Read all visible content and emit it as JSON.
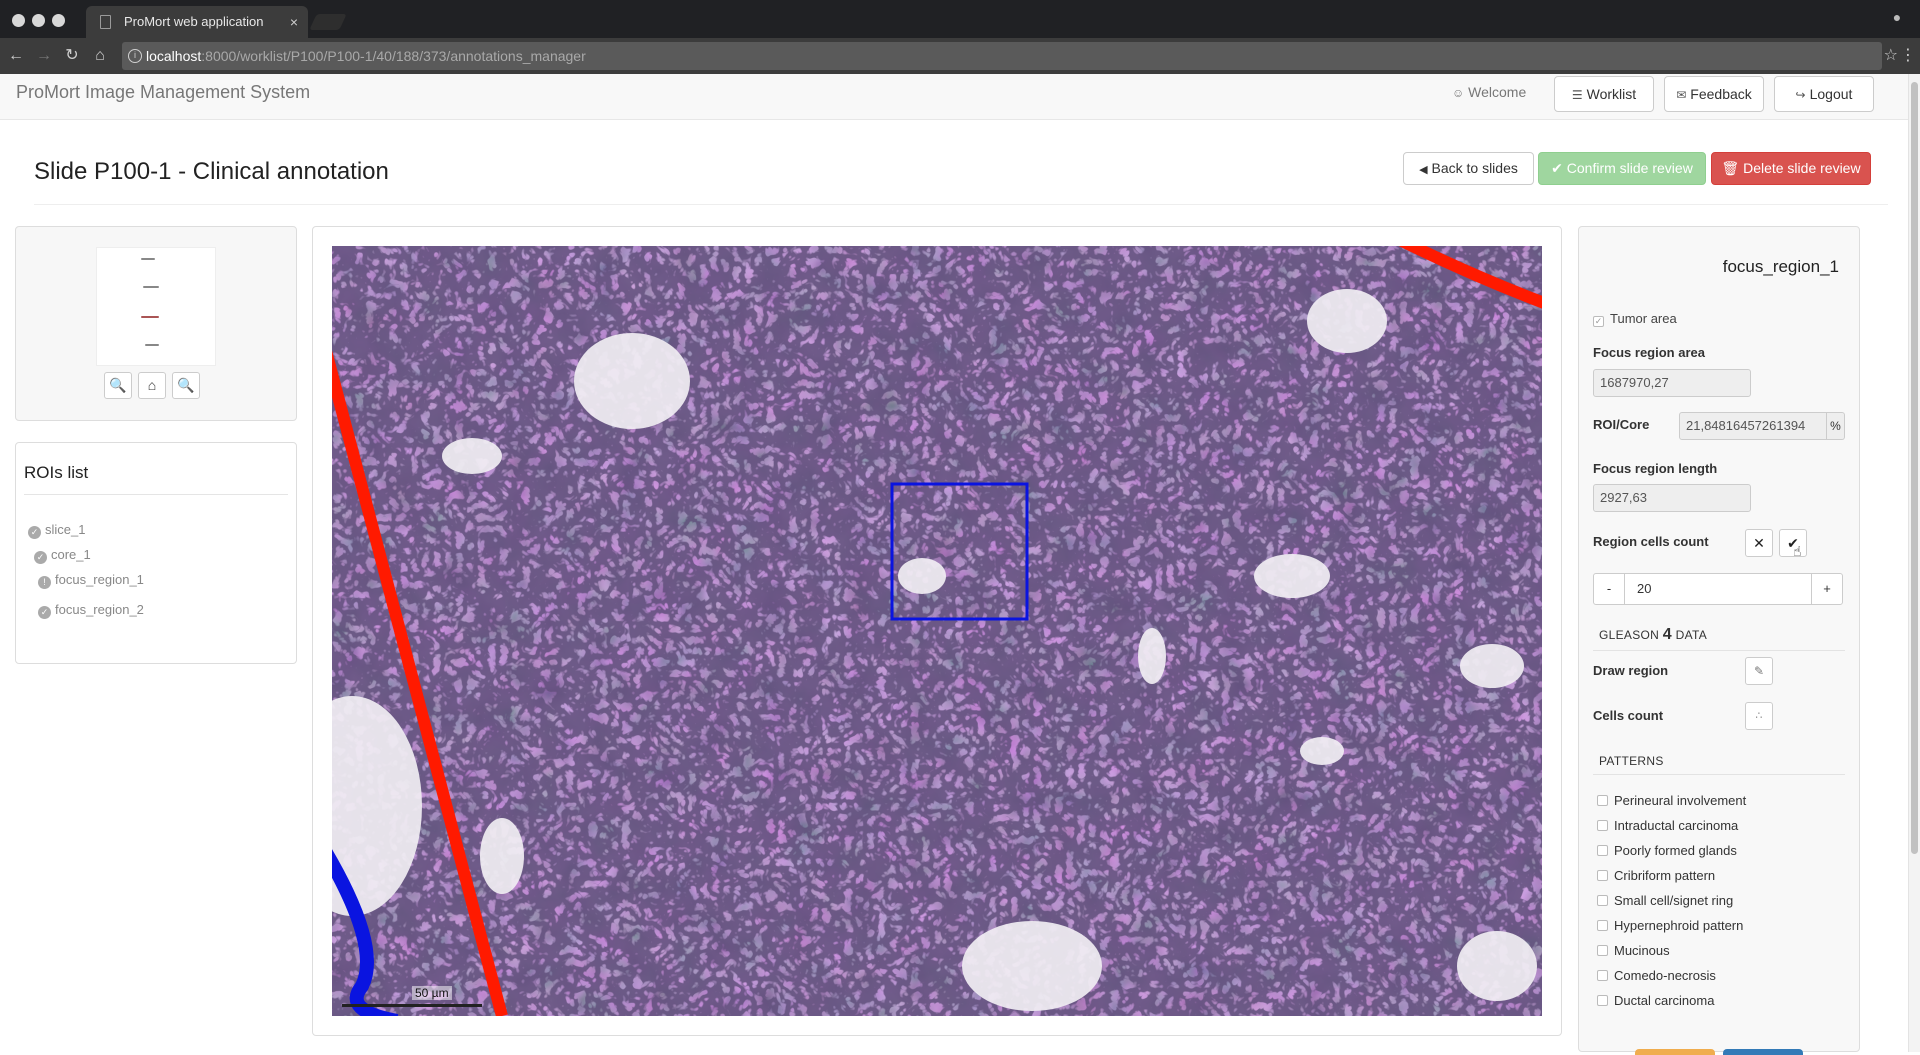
{
  "browser": {
    "tab_title": "ProMort web application",
    "tab_close": "×",
    "url_host": "localhost",
    "url_rest": ":8000/worklist/P100/P100-1/40/188/373/annotations_manager"
  },
  "navbar": {
    "brand": "ProMort Image Management System",
    "welcome": "Welcome",
    "worklist": "Worklist",
    "feedback": "Feedback",
    "logout": "Logout"
  },
  "page": {
    "title": "Slide P100-1 - Clinical annotation",
    "back_label": "Back to slides",
    "confirm_label": "Confirm slide review",
    "delete_label": "Delete slide review"
  },
  "roi_list": {
    "title": "ROIs list",
    "items": [
      "slice_1",
      "core_1",
      "focus_region_1",
      "focus_region_2"
    ]
  },
  "viewer": {
    "scale_label": "50 µm"
  },
  "focus_region": {
    "name": "focus_region_1",
    "tumor_area_label": "Tumor area",
    "tumor_area_checked": true,
    "area_label": "Focus region area",
    "area_value": "1687970,27",
    "roi_core_label": "ROI/Core",
    "roi_core_value": "21,84816457261394",
    "roi_core_unit": "%",
    "length_label": "Focus region length",
    "length_value": "2927,63",
    "cells_count_label": "Region cells count",
    "stepper_minus": "-",
    "stepper_value": "20",
    "stepper_plus": "+",
    "gleason_prefix": "GLEASON",
    "gleason_grade": "4",
    "gleason_suffix": "DATA",
    "draw_region_label": "Draw region",
    "cells_count_tool_label": "Cells count",
    "patterns_header": "PATTERNS",
    "patterns": [
      "Perineural involvement",
      "Intraductal carcinoma",
      "Poorly formed glands",
      "Cribriform pattern",
      "Small cell/signet ring",
      "Hypernephroid pattern",
      "Mucinous",
      "Comedo-necrosis",
      "Ductal carcinoma"
    ]
  },
  "colors": {
    "confirm_green": "#9fd69f",
    "delete_red": "#d9534f",
    "roi_red": "#ff1a00",
    "roi_blue": "#0a14e0",
    "tissue_purple": "#7a5a86"
  }
}
